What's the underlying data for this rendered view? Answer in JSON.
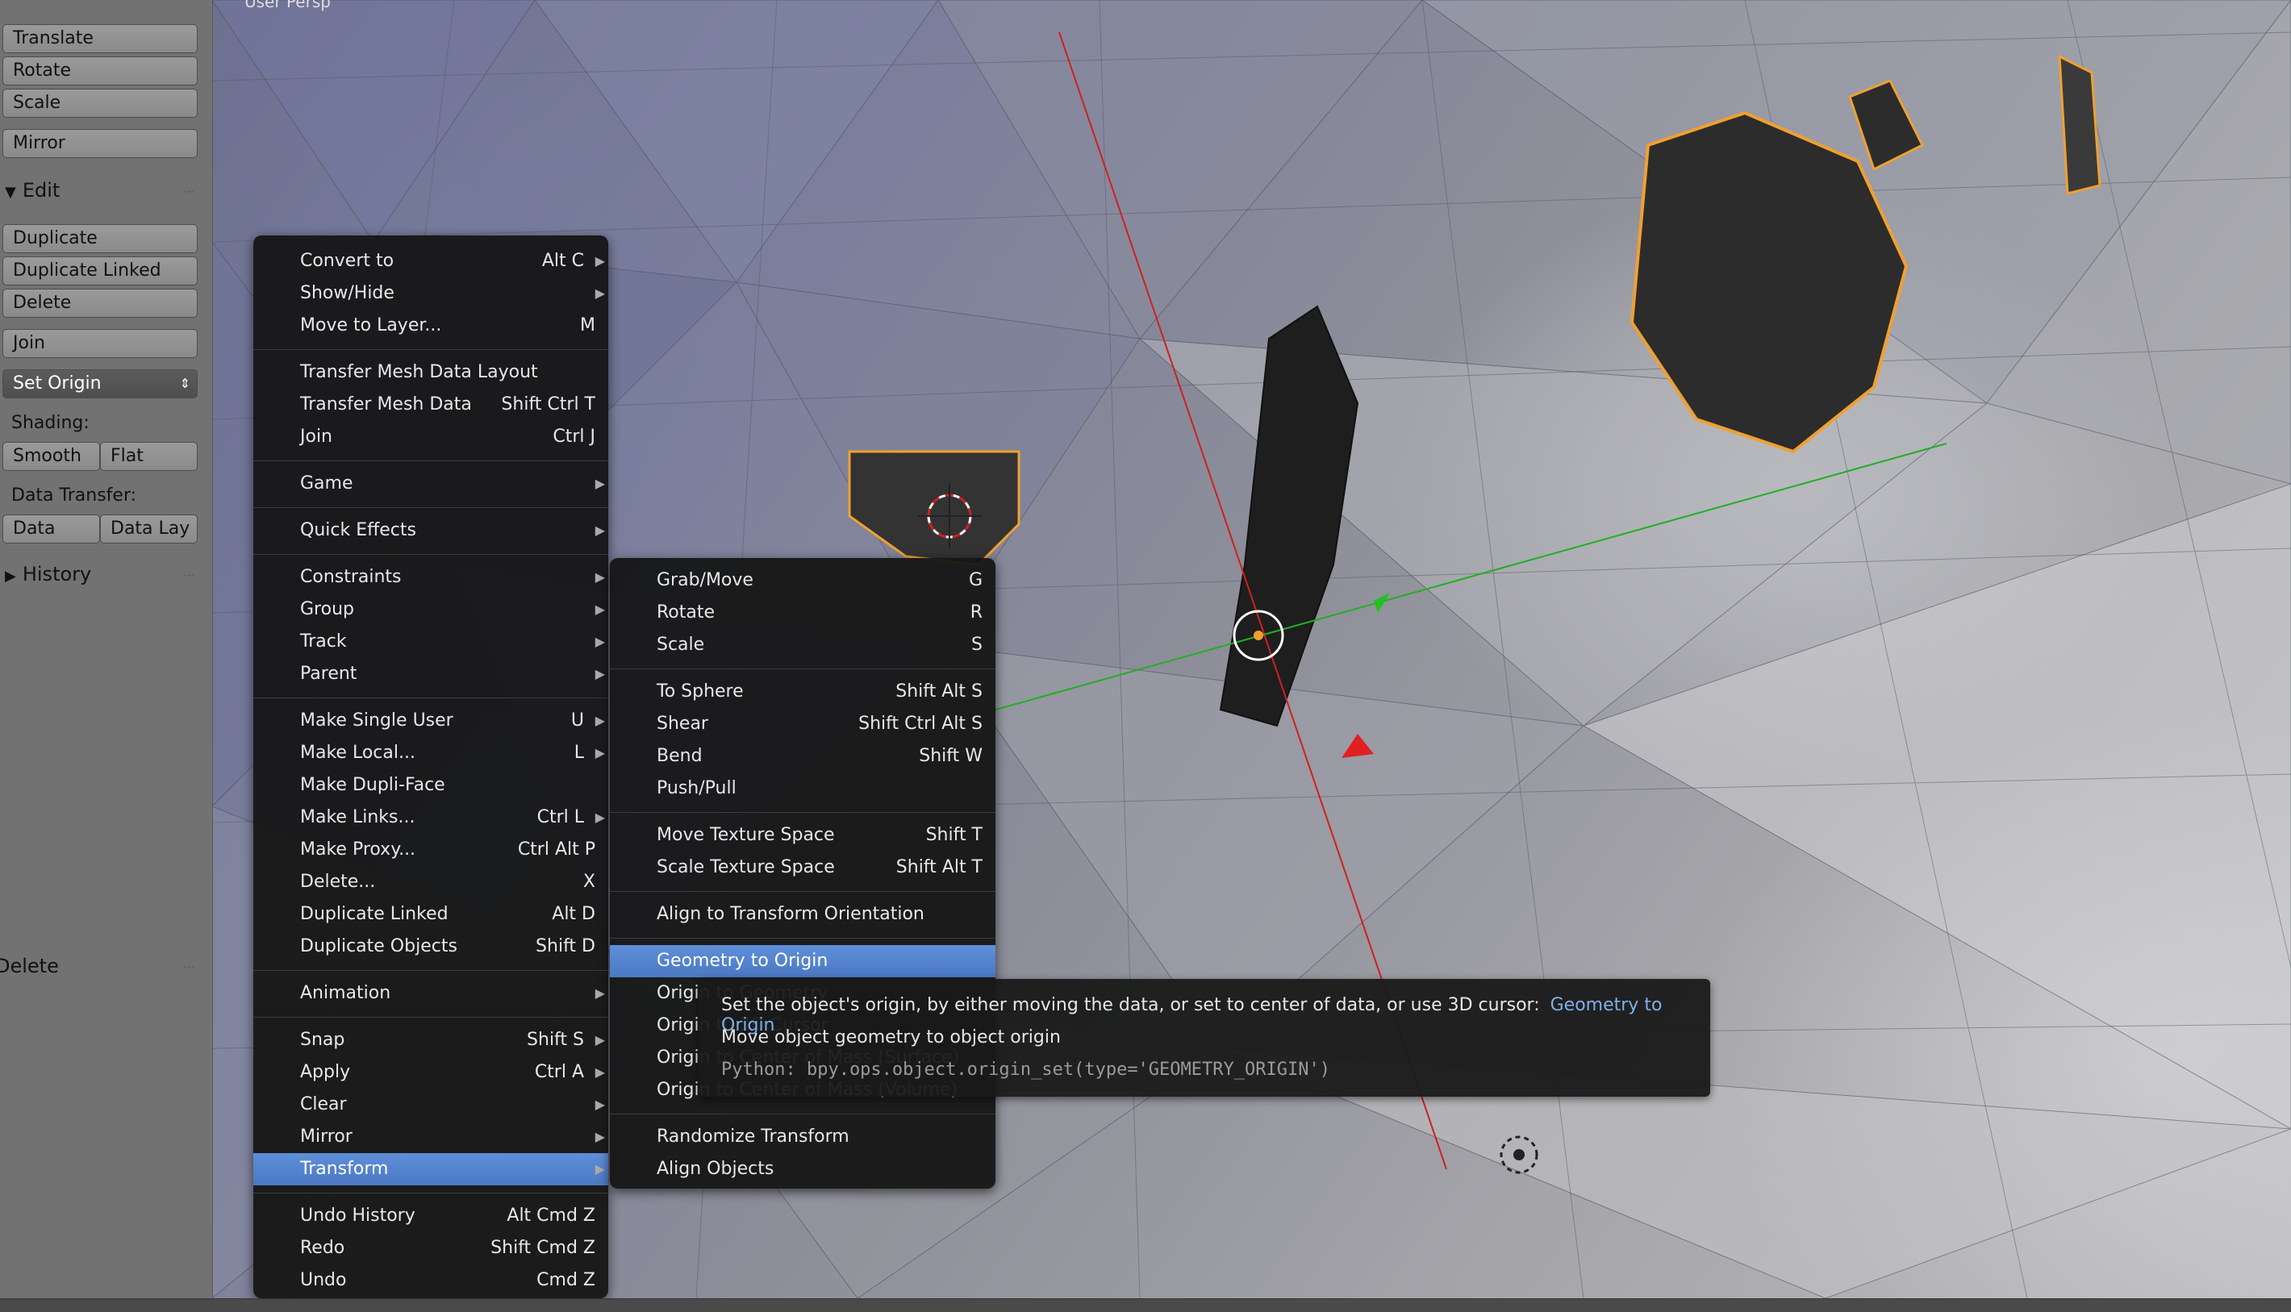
{
  "viewport": {
    "label": "User Persp"
  },
  "toolshelf": {
    "transform_buttons": [
      "Translate",
      "Rotate",
      "Scale"
    ],
    "mirror": "Mirror",
    "edit_header": "Edit",
    "edit_buttons": [
      "Duplicate",
      "Duplicate Linked",
      "Delete"
    ],
    "join": "Join",
    "set_origin": "Set Origin",
    "shading_label": "Shading:",
    "shading_smooth": "Smooth",
    "shading_flat": "Flat",
    "data_transfer_label": "Data Transfer:",
    "data_transfer_data": "Data",
    "data_transfer_layout": "Data Lay",
    "history_header": "History",
    "delete_panel": "Delete"
  },
  "object_menu": {
    "groups": [
      [
        {
          "label": "Convert to",
          "shortcut": "Alt C",
          "sub": true
        },
        {
          "label": "Show/Hide",
          "shortcut": "",
          "sub": true
        },
        {
          "label": "Move to Layer...",
          "shortcut": "M",
          "sub": false
        }
      ],
      [
        {
          "label": "Transfer Mesh Data Layout",
          "shortcut": "",
          "sub": false
        },
        {
          "label": "Transfer Mesh Data",
          "shortcut": "Shift Ctrl T",
          "sub": false
        },
        {
          "label": "Join",
          "shortcut": "Ctrl J",
          "sub": false
        }
      ],
      [
        {
          "label": "Game",
          "shortcut": "",
          "sub": true
        }
      ],
      [
        {
          "label": "Quick Effects",
          "shortcut": "",
          "sub": true
        }
      ],
      [
        {
          "label": "Constraints",
          "shortcut": "",
          "sub": true
        },
        {
          "label": "Group",
          "shortcut": "",
          "sub": true
        },
        {
          "label": "Track",
          "shortcut": "",
          "sub": true
        },
        {
          "label": "Parent",
          "shortcut": "",
          "sub": true
        }
      ],
      [
        {
          "label": "Make Single User",
          "shortcut": "U",
          "sub": true
        },
        {
          "label": "Make Local...",
          "shortcut": "L",
          "sub": true
        },
        {
          "label": "Make Dupli-Face",
          "shortcut": "",
          "sub": false
        },
        {
          "label": "Make Links...",
          "shortcut": "Ctrl L",
          "sub": true
        },
        {
          "label": "Make Proxy...",
          "shortcut": "Ctrl Alt P",
          "sub": false
        },
        {
          "label": "Delete...",
          "shortcut": "X",
          "sub": false
        },
        {
          "label": "Duplicate Linked",
          "shortcut": "Alt D",
          "sub": false
        },
        {
          "label": "Duplicate Objects",
          "shortcut": "Shift D",
          "sub": false
        }
      ],
      [
        {
          "label": "Animation",
          "shortcut": "",
          "sub": true
        }
      ],
      [
        {
          "label": "Snap",
          "shortcut": "Shift S",
          "sub": true
        },
        {
          "label": "Apply",
          "shortcut": "Ctrl A",
          "sub": true
        },
        {
          "label": "Clear",
          "shortcut": "",
          "sub": true
        },
        {
          "label": "Mirror",
          "shortcut": "",
          "sub": true
        },
        {
          "label": "Transform",
          "shortcut": "",
          "sub": true,
          "highlight": true
        }
      ],
      [
        {
          "label": "Undo History",
          "shortcut": "Alt Cmd Z",
          "sub": false
        },
        {
          "label": "Redo",
          "shortcut": "Shift Cmd Z",
          "sub": false
        },
        {
          "label": "Undo",
          "shortcut": "Cmd Z",
          "sub": false
        }
      ]
    ]
  },
  "transform_menu": {
    "groups": [
      [
        {
          "label": "Grab/Move",
          "shortcut": "G"
        },
        {
          "label": "Rotate",
          "shortcut": "R"
        },
        {
          "label": "Scale",
          "shortcut": "S"
        }
      ],
      [
        {
          "label": "To Sphere",
          "shortcut": "Shift Alt S"
        },
        {
          "label": "Shear",
          "shortcut": "Shift Ctrl Alt S"
        },
        {
          "label": "Bend",
          "shortcut": "Shift W"
        },
        {
          "label": "Push/Pull",
          "shortcut": ""
        }
      ],
      [
        {
          "label": "Move Texture Space",
          "shortcut": "Shift T"
        },
        {
          "label": "Scale Texture Space",
          "shortcut": "Shift Alt T"
        }
      ],
      [
        {
          "label": "Align to Transform Orientation",
          "shortcut": ""
        }
      ],
      [
        {
          "label": "Geometry to Origin",
          "shortcut": "",
          "highlight": true
        },
        {
          "label": "Origin to Geometry",
          "shortcut": ""
        },
        {
          "label": "Origin to 3D Cursor",
          "shortcut": ""
        },
        {
          "label": "Origin to Center of Mass (Surface)",
          "shortcut": ""
        },
        {
          "label": "Origin to Center of Mass (Volume)",
          "shortcut": ""
        }
      ],
      [
        {
          "label": "Randomize Transform",
          "shortcut": ""
        },
        {
          "label": "Align Objects",
          "shortcut": ""
        }
      ]
    ]
  },
  "tooltip": {
    "description": "Set the object's origin, by either moving the data, or set to center of data, or use 3D cursor:",
    "enum_value": "Geometry to Origin",
    "detail": "Move object geometry to object origin",
    "python": "Python: bpy.ops.object.origin_set(type='GEOMETRY_ORIGIN')"
  },
  "colors": {
    "menu_highlight": "#5680cc",
    "selection_outline": "#f0a030",
    "x_axis": "#d02020",
    "y_axis": "#20b020"
  }
}
